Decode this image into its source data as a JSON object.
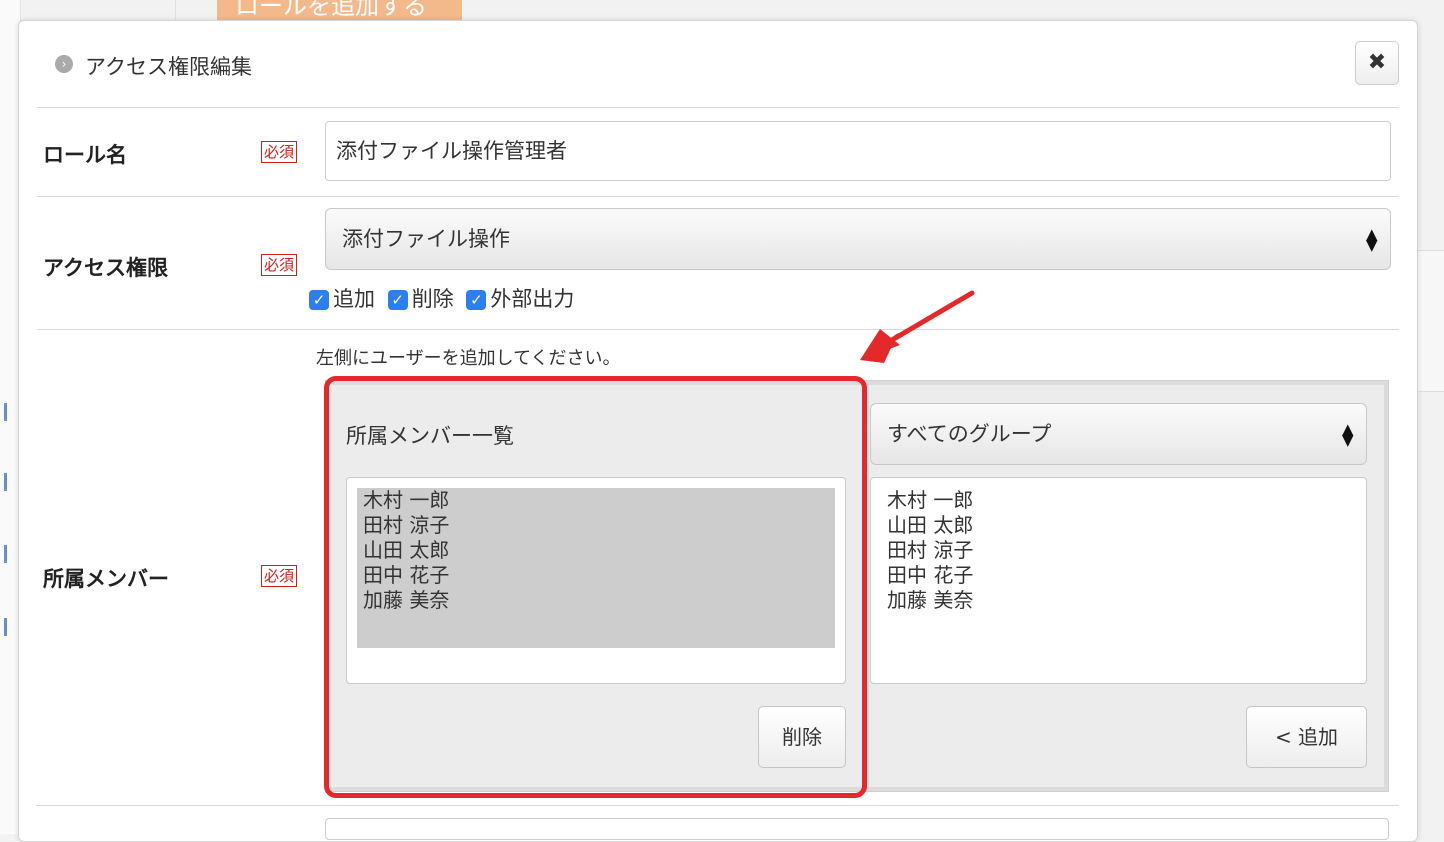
{
  "background": {
    "add_role_button": "ロールを追加する"
  },
  "dialog": {
    "title": "アクセス権限編集",
    "close_icon": "close-icon"
  },
  "role_name": {
    "label": "ロール名",
    "required": "必須",
    "value": "添付ファイル操作管理者"
  },
  "access": {
    "label": "アクセス権限",
    "required": "必須",
    "selected": "添付ファイル操作",
    "options": [
      {
        "label": "追加",
        "checked": true
      },
      {
        "label": "削除",
        "checked": true
      },
      {
        "label": "外部出力",
        "checked": true
      }
    ]
  },
  "members": {
    "label": "所属メンバー",
    "required": "必須",
    "note": "左側にユーザーを追加してください。",
    "left_title": "所属メンバー一覧",
    "current": [
      "木村 一郎",
      "田村 涼子",
      "山田 太郎",
      "田中 花子",
      "加藤 美奈"
    ],
    "remove_button": "削除",
    "group_selected": "すべてのグループ",
    "available": [
      "木村 一郎",
      "山田 太郎",
      "田村 涼子",
      "田中 花子",
      "加藤 美奈"
    ],
    "add_button": "< 追加"
  },
  "colors": {
    "highlight": "#e5282a",
    "required": "#d0201a",
    "checkbox": "#2d7ff0"
  }
}
